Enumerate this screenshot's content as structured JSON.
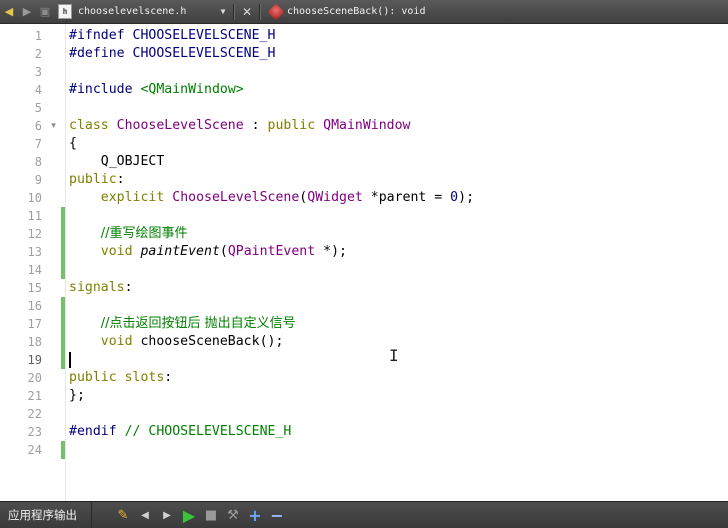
{
  "toolbar": {
    "back_icon": "arrow-left-icon",
    "forward_icon": "arrow-right-icon",
    "lock_icon": "lock-icon",
    "file_name": "chooselevelscene.h",
    "file_type_glyph": "h",
    "symbol": "chooseSceneBack(): void",
    "dropdown_glyph": "▼",
    "close_glyph": "✕"
  },
  "editor": {
    "lines": [
      {
        "n": "1",
        "tokens": [
          {
            "t": "#ifndef",
            "c": "pp"
          },
          {
            "t": " CHOOSELEVELSCENE_H",
            "c": "pp"
          }
        ]
      },
      {
        "n": "2",
        "tokens": [
          {
            "t": "#define",
            "c": "pp"
          },
          {
            "t": " CHOOSELEVELSCENE_H",
            "c": "pp"
          }
        ]
      },
      {
        "n": "3",
        "tokens": []
      },
      {
        "n": "4",
        "tokens": [
          {
            "t": "#include",
            "c": "pp"
          },
          {
            "t": " ",
            "c": ""
          },
          {
            "t": "<QMainWindow>",
            "c": "str"
          }
        ]
      },
      {
        "n": "5",
        "tokens": []
      },
      {
        "n": "6",
        "fold": "▾",
        "tokens": [
          {
            "t": "class",
            "c": "k"
          },
          {
            "t": " ",
            "c": ""
          },
          {
            "t": "ChooseLevelScene",
            "c": "cls"
          },
          {
            "t": " : ",
            "c": ""
          },
          {
            "t": "public",
            "c": "k"
          },
          {
            "t": " ",
            "c": ""
          },
          {
            "t": "QMainWindow",
            "c": "cls"
          }
        ]
      },
      {
        "n": "7",
        "tokens": [
          {
            "t": "{",
            "c": ""
          }
        ]
      },
      {
        "n": "8",
        "tokens": [
          {
            "t": "    Q_OBJECT",
            "c": ""
          }
        ]
      },
      {
        "n": "9",
        "tokens": [
          {
            "t": "public",
            "c": "k"
          },
          {
            "t": ":",
            "c": ""
          }
        ]
      },
      {
        "n": "10",
        "tokens": [
          {
            "t": "    ",
            "c": ""
          },
          {
            "t": "explicit",
            "c": "k"
          },
          {
            "t": " ",
            "c": ""
          },
          {
            "t": "ChooseLevelScene",
            "c": "cls"
          },
          {
            "t": "(",
            "c": ""
          },
          {
            "t": "QWidget",
            "c": "cls"
          },
          {
            "t": " *parent = ",
            "c": ""
          },
          {
            "t": "0",
            "c": "num"
          },
          {
            "t": ");",
            "c": ""
          }
        ]
      },
      {
        "n": "11",
        "changed": true,
        "tokens": []
      },
      {
        "n": "12",
        "changed": true,
        "tokens": [
          {
            "t": "    ",
            "c": ""
          },
          {
            "t": "//重写绘图事件",
            "c": "cm zh"
          }
        ]
      },
      {
        "n": "13",
        "changed": true,
        "tokens": [
          {
            "t": "    ",
            "c": ""
          },
          {
            "t": "void",
            "c": "k"
          },
          {
            "t": " ",
            "c": ""
          },
          {
            "t": "paintEvent",
            "c": "fn"
          },
          {
            "t": "(",
            "c": ""
          },
          {
            "t": "QPaintEvent",
            "c": "cls"
          },
          {
            "t": " *);",
            "c": ""
          }
        ]
      },
      {
        "n": "14",
        "changed": true,
        "tokens": []
      },
      {
        "n": "15",
        "tokens": [
          {
            "t": "signals",
            "c": "k"
          },
          {
            "t": ":",
            "c": ""
          }
        ]
      },
      {
        "n": "16",
        "changed": true,
        "tokens": []
      },
      {
        "n": "17",
        "changed": true,
        "tokens": [
          {
            "t": "    ",
            "c": ""
          },
          {
            "t": "//点击返回按钮后 抛出自定义信号",
            "c": "cm zh"
          }
        ]
      },
      {
        "n": "18",
        "changed": true,
        "tokens": [
          {
            "t": "    ",
            "c": ""
          },
          {
            "t": "void",
            "c": "k"
          },
          {
            "t": " chooseSceneBack();",
            "c": ""
          }
        ]
      },
      {
        "n": "19",
        "changed": true,
        "current": true,
        "tokens": []
      },
      {
        "n": "20",
        "tokens": [
          {
            "t": "public",
            "c": "k"
          },
          {
            "t": " ",
            "c": ""
          },
          {
            "t": "slots",
            "c": "k"
          },
          {
            "t": ":",
            "c": ""
          }
        ]
      },
      {
        "n": "21",
        "tokens": [
          {
            "t": "};",
            "c": ""
          }
        ]
      },
      {
        "n": "22",
        "tokens": []
      },
      {
        "n": "23",
        "tokens": [
          {
            "t": "#endif",
            "c": "pp"
          },
          {
            "t": " ",
            "c": ""
          },
          {
            "t": "// CHOOSELEVELSCENE_H",
            "c": "cm"
          }
        ]
      },
      {
        "n": "24",
        "changed": true,
        "tokens": []
      }
    ]
  },
  "bottom": {
    "panel_title": "应用程序输出",
    "icons": [
      "clear-output-icon",
      "prev-icon",
      "next-icon",
      "run-icon",
      "stop-icon",
      "attach-icon",
      "zoom-in-icon",
      "zoom-out-icon"
    ]
  },
  "colors": {
    "keyword": "#808000",
    "preprocessor": "#000080",
    "class": "#800080",
    "comment": "#008000",
    "change_bar": "#74c16b"
  }
}
